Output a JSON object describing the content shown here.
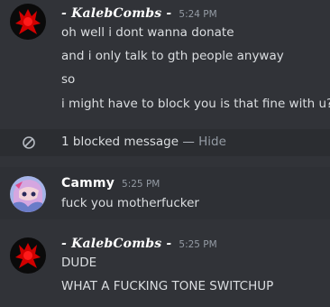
{
  "messages": [
    {
      "username": "- KalebCombs -",
      "timestamp": "5:24 PM",
      "lines": [
        "oh well i dont wanna donate",
        "and i only talk to gth people anyway",
        "so",
        "i might have to block you is that fine with u?"
      ]
    },
    {
      "username": "Cammy",
      "timestamp": "5:25 PM",
      "lines": [
        "fuck you motherfucker"
      ]
    },
    {
      "username": "- KalebCombs -",
      "timestamp": "5:25 PM",
      "lines": [
        "DUDE",
        "WHAT A FUCKING TONE SWITCHUP"
      ]
    }
  ],
  "blocked": {
    "count_text": "1 blocked message",
    "separator": " — ",
    "hide_label": "Hide"
  },
  "colors": {
    "background": "#313338",
    "blocked_row": "#2b2d31",
    "timestamp": "#949ba4",
    "text": "#dbdee1"
  },
  "icons": {
    "blocked": "blocked-circle-icon"
  }
}
